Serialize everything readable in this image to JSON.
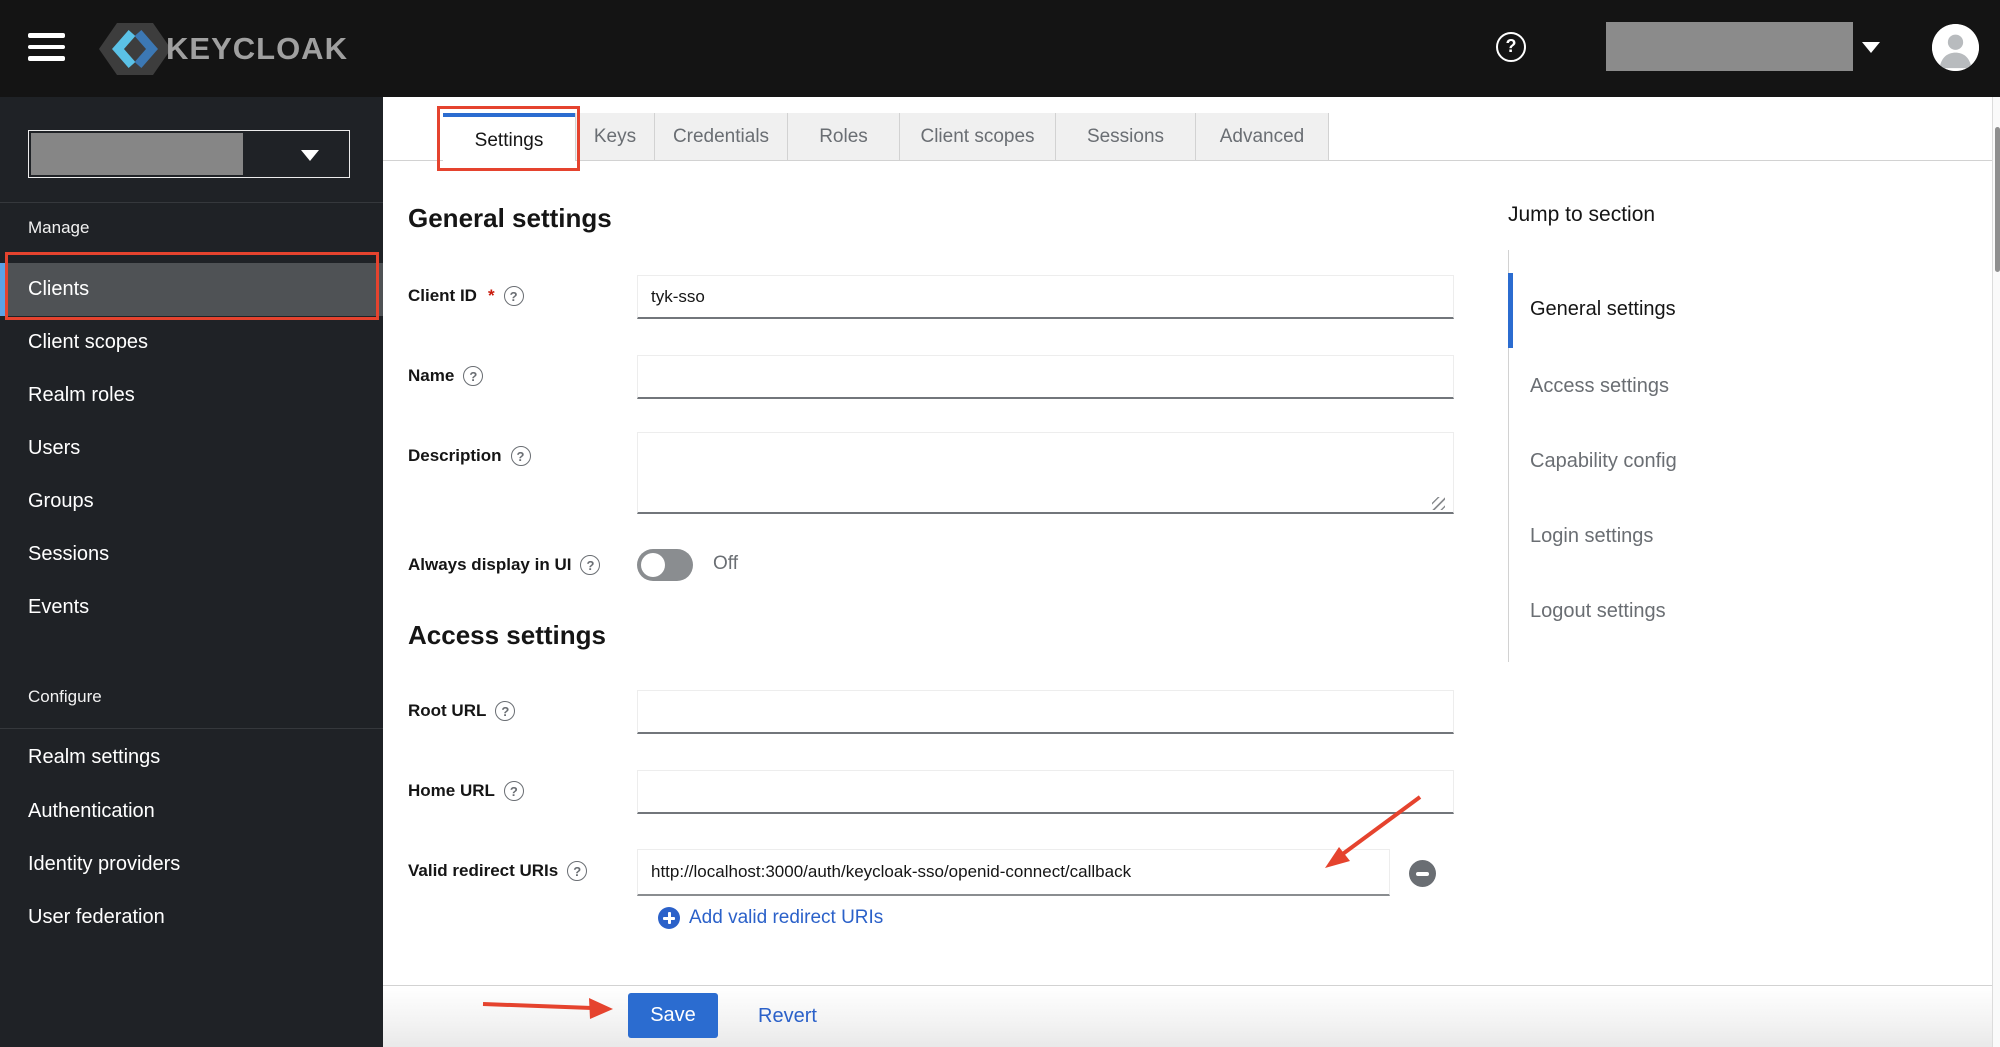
{
  "topbar": {
    "brand": "KEYCLOAK"
  },
  "icons": {
    "question_mark": "?"
  },
  "sidebar": {
    "manage_header": "Manage",
    "manage_items": [
      "Clients",
      "Client scopes",
      "Realm roles",
      "Users",
      "Groups",
      "Sessions",
      "Events"
    ],
    "configure_header": "Configure",
    "configure_items": [
      "Realm settings",
      "Authentication",
      "Identity providers",
      "User federation"
    ]
  },
  "tabs": {
    "items": [
      "Settings",
      "Keys",
      "Credentials",
      "Roles",
      "Client scopes",
      "Sessions",
      "Advanced"
    ],
    "active": "Settings"
  },
  "form": {
    "general_heading": "General settings",
    "client_id_label": "Client ID",
    "required_marker": "*",
    "client_id_value": "tyk-sso",
    "name_label": "Name",
    "description_label": "Description",
    "always_display_label": "Always display in UI",
    "always_display_state": "Off",
    "access_heading": "Access settings",
    "root_url_label": "Root URL",
    "home_url_label": "Home URL",
    "valid_redirect_label": "Valid redirect URIs",
    "valid_redirect_value": "http://localhost:3000/auth/keycloak-sso/openid-connect/callback",
    "add_redirect_label": "Add valid redirect URIs"
  },
  "jump": {
    "title": "Jump to section",
    "items": [
      "General settings",
      "Access settings",
      "Capability config",
      "Login settings",
      "Logout settings"
    ]
  },
  "footer": {
    "save_label": "Save",
    "revert_label": "Revert"
  },
  "colors": {
    "accent_blue": "#2b6cd0",
    "annotation_red": "#e5432e",
    "link_blue": "#2b61c9",
    "topbar_black": "#141414",
    "sidebar_dark": "#1f2226"
  }
}
